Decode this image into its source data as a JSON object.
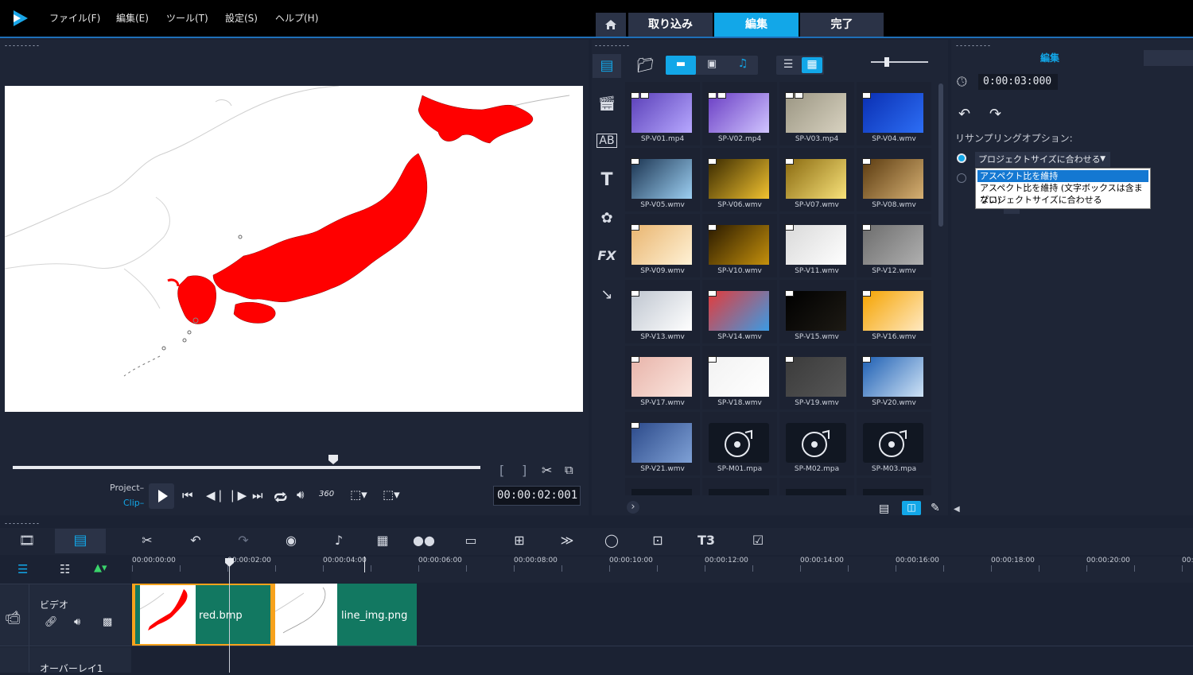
{
  "menu": [
    "ファイル(F)",
    "編集(E)",
    "ツール(T)",
    "設定(S)",
    "ヘルプ(H)"
  ],
  "tabs": {
    "import": "取り込み",
    "edit": "編集",
    "finish": "完了"
  },
  "preview": {
    "project_label": "Project",
    "clip_label": "Clip",
    "timecode": "00:00:02:001",
    "bracket_in": "[",
    "bracket_out": "]",
    "view360": "360"
  },
  "library": {
    "items": [
      {
        "label": "SP-V01.mp4",
        "colors": [
          "#5a3fb8",
          "#b7a8ff"
        ]
      },
      {
        "label": "SP-V02.mp4",
        "colors": [
          "#6a3ec4",
          "#d0c4ff"
        ]
      },
      {
        "label": "SP-V03.mp4",
        "colors": [
          "#9b9683",
          "#d8d2c0"
        ]
      },
      {
        "label": "SP-V04.wmv",
        "colors": [
          "#0a2fb2",
          "#2d6ef5"
        ]
      },
      {
        "label": "SP-V05.wmv",
        "colors": [
          "#1c3552",
          "#9ccff2"
        ]
      },
      {
        "label": "SP-V06.wmv",
        "colors": [
          "#3a2a00",
          "#f1c230"
        ]
      },
      {
        "label": "SP-V07.wmv",
        "colors": [
          "#8a6a10",
          "#f8e27a"
        ]
      },
      {
        "label": "SP-V08.wmv",
        "colors": [
          "#5b3b10",
          "#d6b073"
        ]
      },
      {
        "label": "SP-V09.wmv",
        "colors": [
          "#e9b570",
          "#fff2d6"
        ]
      },
      {
        "label": "SP-V10.wmv",
        "colors": [
          "#2a1a00",
          "#c4900c"
        ]
      },
      {
        "label": "SP-V11.wmv",
        "colors": [
          "#d9d9d9",
          "#ffffff"
        ]
      },
      {
        "label": "SP-V12.wmv",
        "colors": [
          "#6d6d6d",
          "#b0b0b0"
        ]
      },
      {
        "label": "SP-V13.wmv",
        "colors": [
          "#bfc6d0",
          "#ffffff"
        ]
      },
      {
        "label": "SP-V14.wmv",
        "colors": [
          "#e43b3b",
          "#3b9be4"
        ]
      },
      {
        "label": "SP-V15.wmv",
        "colors": [
          "#000000",
          "#1d1a14"
        ]
      },
      {
        "label": "SP-V16.wmv",
        "colors": [
          "#f5a300",
          "#ffe9c2"
        ]
      },
      {
        "label": "SP-V17.wmv",
        "colors": [
          "#e8b4aa",
          "#fbe7e0"
        ]
      },
      {
        "label": "SP-V18.wmv",
        "colors": [
          "#f2f2f2",
          "#ffffff"
        ]
      },
      {
        "label": "SP-V19.wmv",
        "colors": [
          "#3b3b3b",
          "#565656"
        ]
      },
      {
        "label": "SP-V20.wmv",
        "colors": [
          "#1e5fb3",
          "#cfe3f6"
        ]
      },
      {
        "label": "SP-V21.wmv",
        "colors": [
          "#2c4a8a",
          "#7fa1d6"
        ]
      },
      {
        "label": "SP-M01.mpa",
        "colors": [
          "#111722",
          "#111722"
        ]
      },
      {
        "label": "SP-M02.mpa",
        "colors": [
          "#111722",
          "#111722"
        ]
      },
      {
        "label": "SP-M03.mpa",
        "colors": [
          "#111722",
          "#111722"
        ]
      }
    ]
  },
  "options": {
    "header": "編集",
    "duration": "0:00:03:000",
    "resampling_label": "リサンプリングオプション:",
    "select_value": "プロジェクトサイズに合わせる",
    "dropdown_options": [
      "アスペクト比を維持",
      "アスペクト比を維持 (文字ボックスは含まない)",
      "プロジェクトサイズに合わせる"
    ],
    "accent": "#12a7e8"
  },
  "timeline": {
    "ruler": [
      "00:00:00:00",
      "00:00:02:00",
      "00:00:04:00",
      "00:00:06:00",
      "00:00:08:00",
      "00:00:10:00",
      "00:00:12:00",
      "00:00:14:00",
      "00:00:16:00",
      "00:00:18:00",
      "00:00:20:00",
      "00:"
    ],
    "tracks": {
      "video": "ビデオ",
      "overlay": "オーバーレイ1"
    },
    "clips": [
      {
        "label": "red.bmp"
      },
      {
        "label": "line_img.png"
      }
    ]
  }
}
